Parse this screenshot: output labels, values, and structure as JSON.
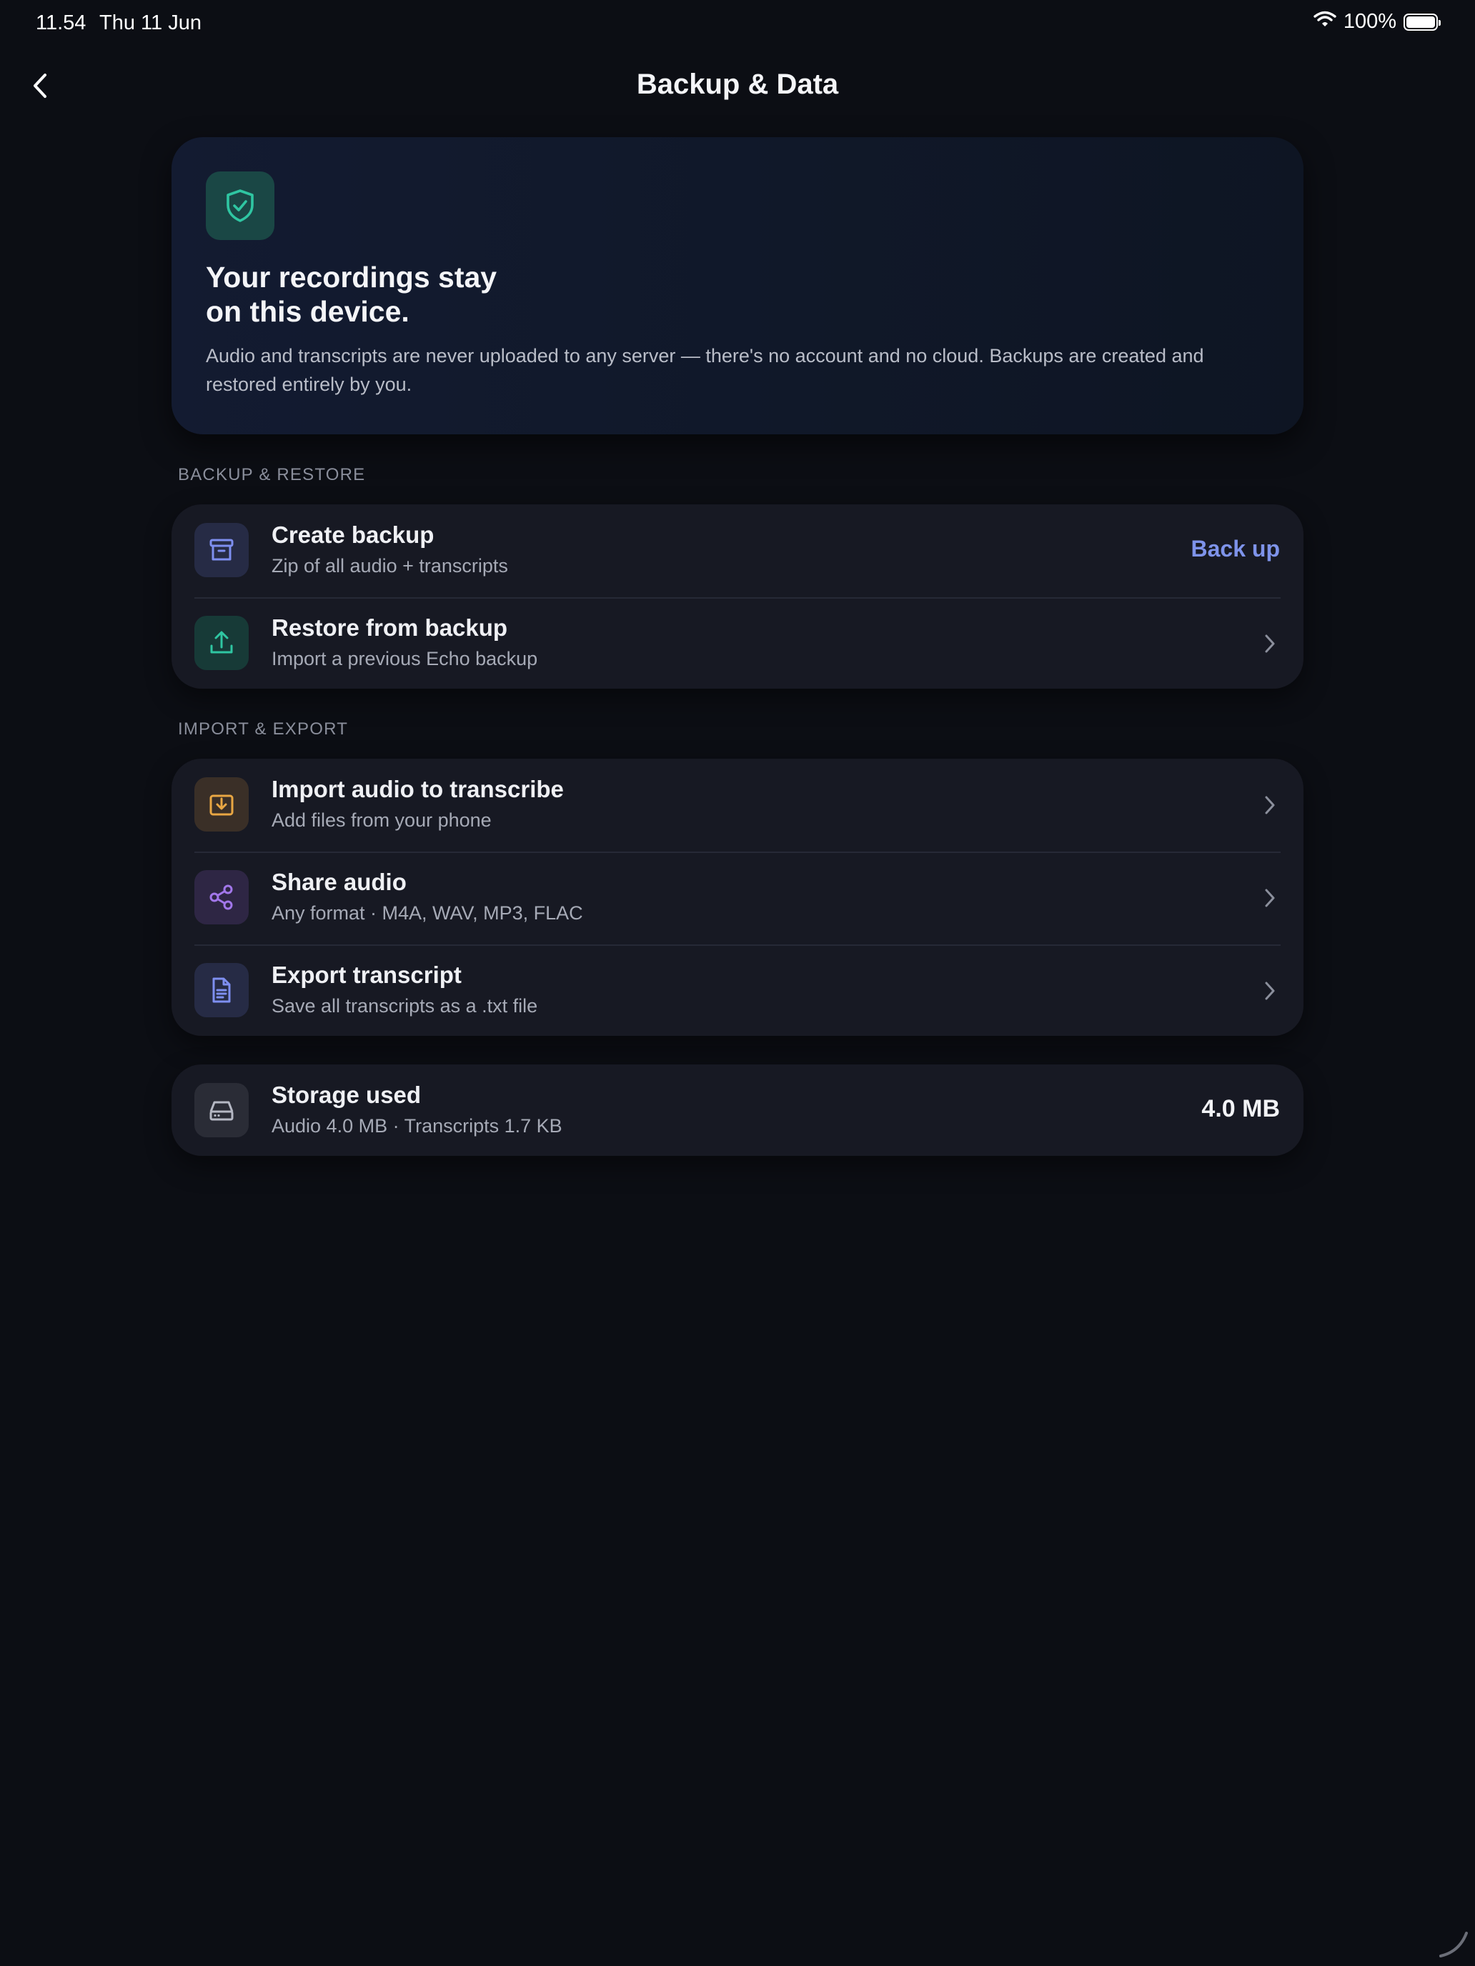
{
  "status_bar": {
    "time": "11.54",
    "date": "Thu 11 Jun",
    "battery": "100%",
    "icons": [
      "wifi-icon",
      "battery-icon"
    ]
  },
  "nav": {
    "title": "Backup & Data",
    "back_icon": "chevron-left-icon"
  },
  "hero": {
    "icon": "shield-check-icon",
    "title": "Your recordings stay\non this device.",
    "description": "Audio and transcripts are never uploaded to any server — there's no account and no cloud. Backups are created and restored entirely by you."
  },
  "sections": {
    "backup_restore": {
      "label": "Backup & Restore",
      "items": [
        {
          "title": "Create backup",
          "subtitle": "Zip of all audio + transcripts",
          "action": "Back up",
          "icon": "archive-box-icon"
        },
        {
          "title": "Restore from backup",
          "subtitle": "Import a previous Echo backup",
          "icon": "upload-icon"
        }
      ]
    },
    "import_export": {
      "label": "Import & Export",
      "items": [
        {
          "title": "Import audio to transcribe",
          "subtitle": "Add files from your phone",
          "icon": "import-tray-icon"
        },
        {
          "title": "Share audio",
          "subtitle": "Any format · M4A, WAV, MP3, FLAC",
          "icon": "share-icon"
        },
        {
          "title": "Export transcript",
          "subtitle": "Save all transcripts as a .txt file",
          "icon": "document-text-icon"
        }
      ]
    },
    "storage": {
      "title": "Storage used",
      "subtitle": "Audio 4.0 MB · Transcripts 1.7 KB",
      "value": "4.0 MB",
      "icon": "hard-drive-icon"
    }
  },
  "colors": {
    "background": "#0c0e14",
    "card": "#171923",
    "accent_link": "#7e93ea",
    "teal": "#2fc6a2",
    "amber": "#e9a743",
    "purple": "#a277ea",
    "indigo": "#7e8ff0"
  }
}
